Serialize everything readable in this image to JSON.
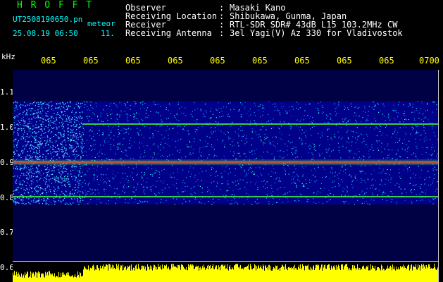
{
  "app": {
    "title": "H R O F F T",
    "file_name": "UT2508190650.pn",
    "file_suffix": "meteor",
    "date_time": "25.08.19 06:50",
    "count": "11."
  },
  "station": {
    "rows": [
      {
        "label": "Observer",
        "value": "Masaki Kano"
      },
      {
        "label": "Receiving Location",
        "value": "Shibukawa, Gunma, Japan"
      },
      {
        "label": "Receiver",
        "value": "RTL-SDR SDR# 43dB L15 103.2MHz CW"
      },
      {
        "label": "Receiving Antenna",
        "value": "3el Yagi(V) Az 330 for Vladivostok"
      }
    ]
  },
  "axis": {
    "unit": "kHz",
    "y_ticks": [
      "1.1",
      "1.0",
      "0.9",
      "0.8",
      "0.7",
      "0.6"
    ],
    "x_ticks": [
      "065",
      "065",
      "065",
      "065",
      "065",
      "065",
      "065",
      "065",
      "065",
      "0700"
    ]
  },
  "spectrogram": {
    "freq_range_khz": [
      0.6,
      1.1
    ],
    "signal_lines_khz": [
      0.98,
      0.88,
      0.79
    ],
    "strong_line_khz": 0.88
  },
  "colors": {
    "background": "#000000",
    "plot_background": "#000088",
    "title_green": "#00ff00",
    "info_white": "#ffffff",
    "tick_yellow": "#ffff00",
    "level_yellow": "#ffff00",
    "strong_signal": "#ff2020",
    "line_signal": "#40ff40"
  }
}
